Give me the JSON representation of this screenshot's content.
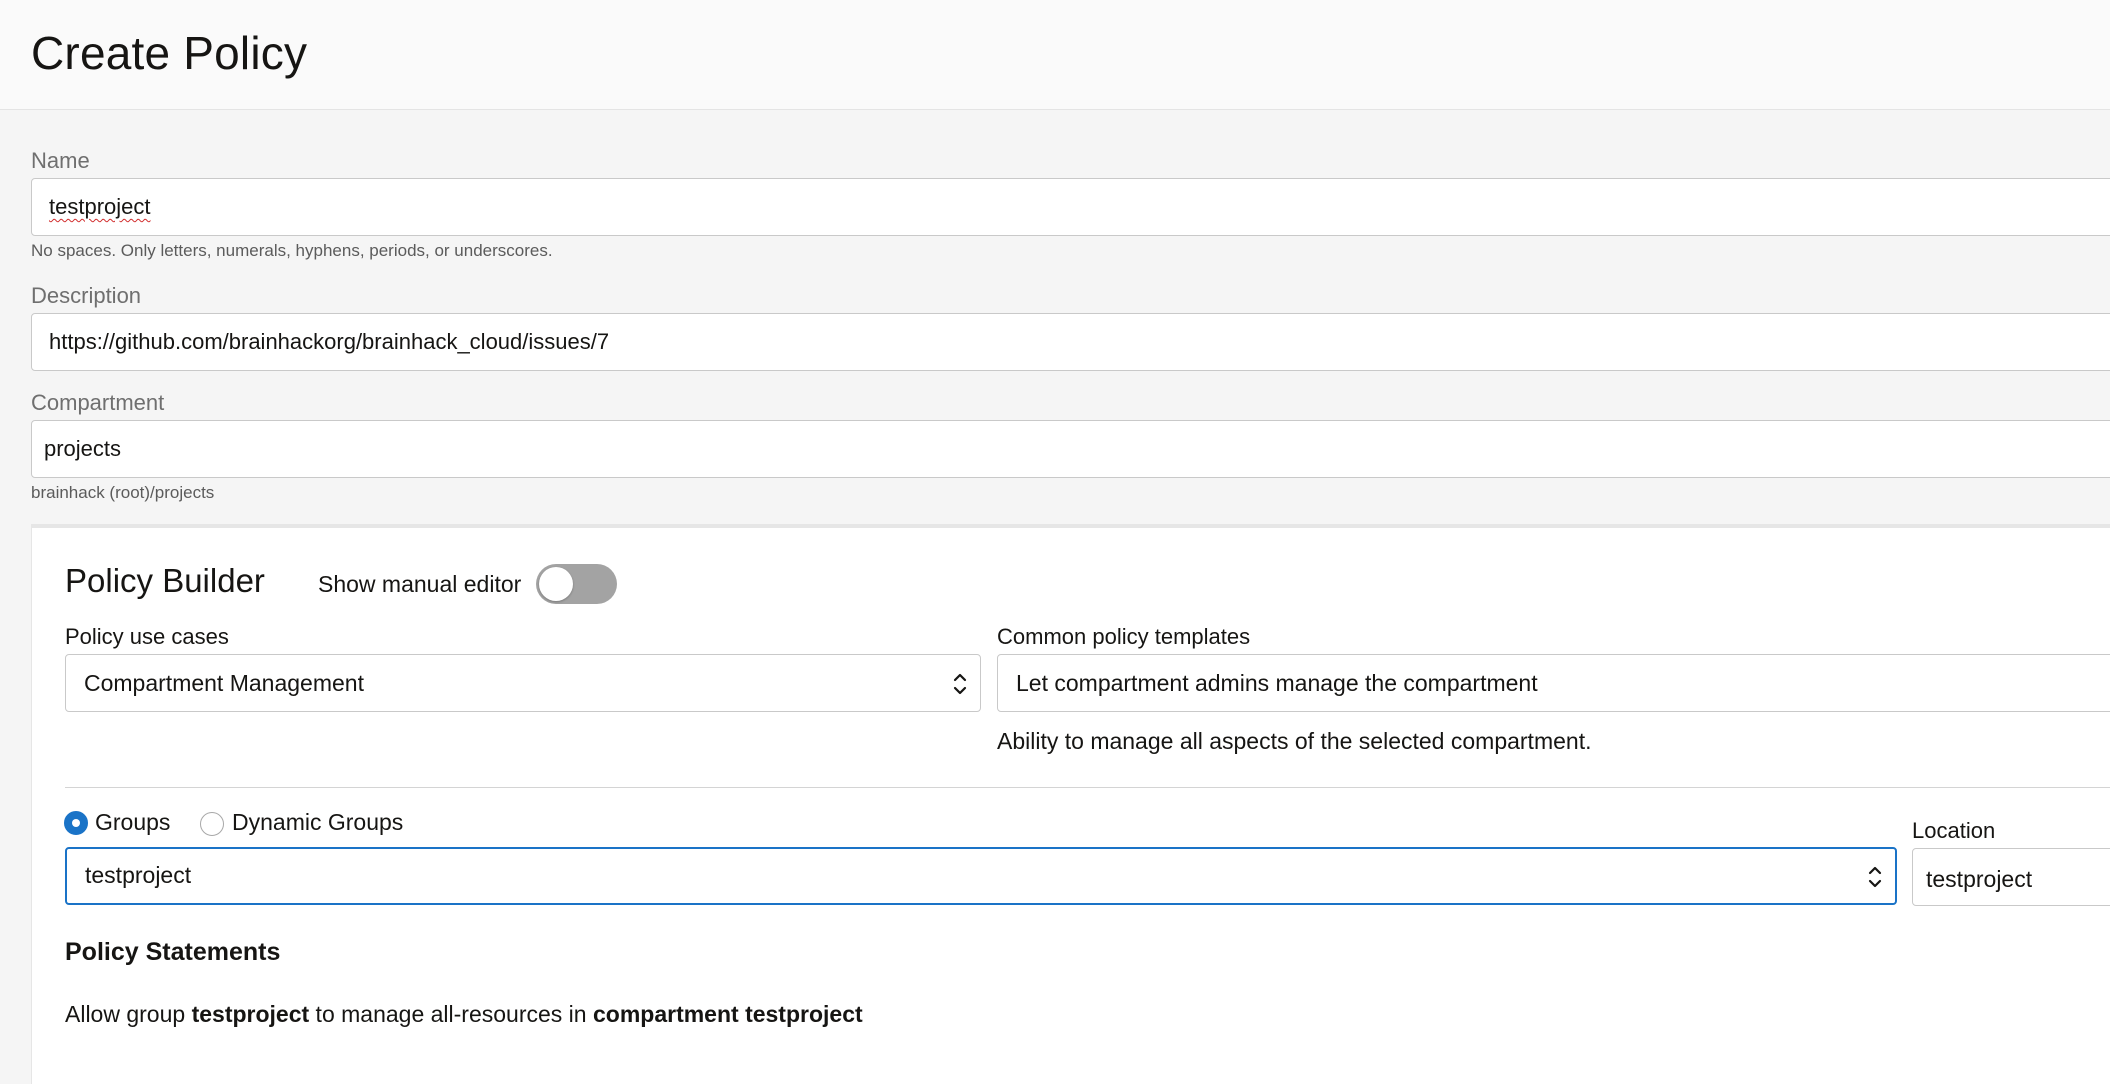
{
  "page": {
    "title": "Create Policy"
  },
  "name_field": {
    "label": "Name",
    "value": "testproject",
    "hint": "No spaces. Only letters, numerals, hyphens, periods, or underscores."
  },
  "description_field": {
    "label": "Description",
    "value": "https://github.com/brainhackorg/brainhack_cloud/issues/7"
  },
  "compartment_field": {
    "label": "Compartment",
    "value": "projects",
    "path": "brainhack (root)/projects"
  },
  "policy_builder": {
    "title": "Policy Builder",
    "manual_editor_label": "Show manual editor",
    "manual_editor_enabled": false,
    "use_cases": {
      "label": "Policy use cases",
      "selected": "Compartment Management"
    },
    "templates": {
      "label": "Common policy templates",
      "selected": "Let compartment admins manage the compartment",
      "description": "Ability to manage all aspects of the selected compartment."
    },
    "group_type": {
      "options": [
        "Groups",
        "Dynamic Groups"
      ],
      "selected": "Groups"
    },
    "groups_select": {
      "selected": "testproject"
    },
    "location": {
      "label": "Location",
      "value": "testproject"
    },
    "statements": {
      "title": "Policy Statements",
      "items": [
        {
          "prefix": "Allow group ",
          "group": "testproject",
          "middle": " to manage all-resources in ",
          "target": "compartment testproject"
        }
      ]
    }
  },
  "colors": {
    "accent": "#1a73c7",
    "toggle_off": "#a3a3a3",
    "spell_error": "#d12c2c"
  }
}
